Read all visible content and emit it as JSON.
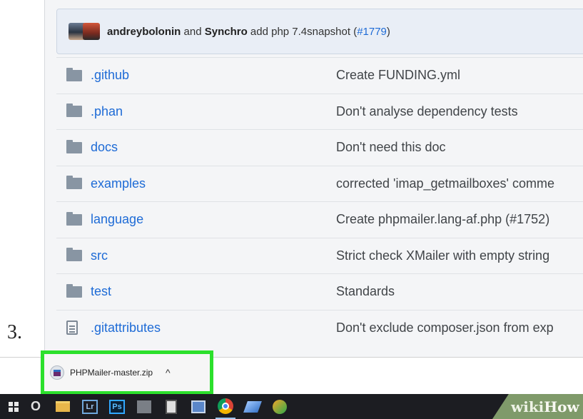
{
  "step": "3.",
  "commit": {
    "author1": "andreybolonin",
    "joiner": " and ",
    "author2": "Synchro",
    "message": " add php 7.4snapshot (",
    "pr": "#1779",
    "close": ")"
  },
  "files": [
    {
      "type": "folder-icon",
      "name": ".github",
      "message": "Create FUNDING.yml"
    },
    {
      "type": "folder-icon",
      "name": ".phan",
      "message": "Don't analyse dependency tests"
    },
    {
      "type": "folder-icon",
      "name": "docs",
      "message": "Don't need this doc"
    },
    {
      "type": "folder-icon",
      "name": "examples",
      "message": "corrected 'imap_getmailboxes' comme"
    },
    {
      "type": "folder-icon",
      "name": "language",
      "message": "Create phpmailer.lang-af.php (#1752)"
    },
    {
      "type": "folder-icon",
      "name": "src",
      "message": "Strict check XMailer with empty string"
    },
    {
      "type": "folder-icon",
      "name": "test",
      "message": "Standards"
    },
    {
      "type": "file-icon",
      "name": ".gitattributes",
      "message": "Don't exclude composer.json from exp"
    }
  ],
  "download": {
    "filename": "PHPMailer-master.zip",
    "chevron": "^"
  },
  "taskbar": {
    "lr_label": "Lr",
    "ps_label": "Ps",
    "search_glyph": "O"
  },
  "watermark": {
    "wiki": "wiki",
    "how": "How"
  },
  "colors": {
    "link": "#1e6bd6",
    "highlight": "#2ce02c",
    "taskbar": "#1c1d22"
  }
}
